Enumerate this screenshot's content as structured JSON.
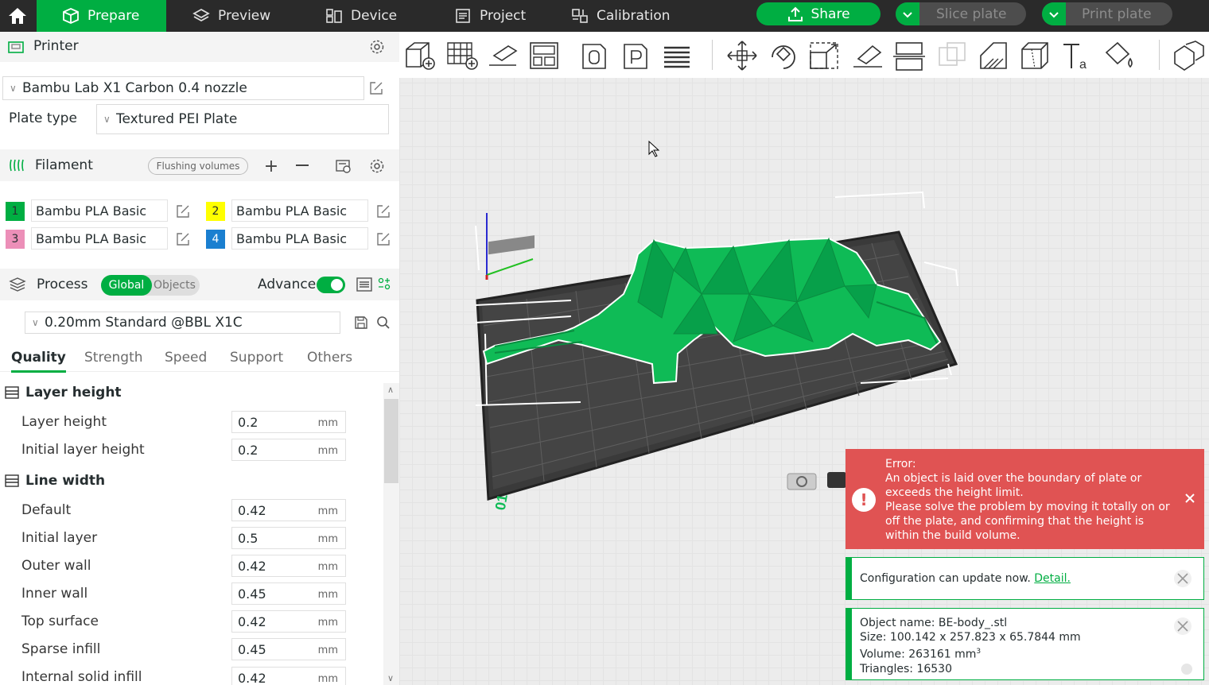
{
  "nav": {
    "tabs": [
      {
        "label": "Prepare"
      },
      {
        "label": "Preview"
      },
      {
        "label": "Device"
      },
      {
        "label": "Project"
      },
      {
        "label": "Calibration"
      }
    ],
    "share_label": "Share",
    "slice_label": "Slice plate",
    "print_label": "Print plate"
  },
  "printer": {
    "section_label": "Printer",
    "preset": "Bambu Lab X1 Carbon 0.4 nozzle",
    "plate_type_label": "Plate type",
    "plate_type": "Textured PEI Plate"
  },
  "filament": {
    "section_label": "Filament",
    "flushing_label": "Flushing volumes",
    "items": [
      {
        "num": "1",
        "name": "Bambu PLA Basic",
        "color": "#00ae42"
      },
      {
        "num": "2",
        "name": "Bambu PLA Basic",
        "color": "#ffff00"
      },
      {
        "num": "3",
        "name": "Bambu PLA Basic",
        "color": "#ec8fb8"
      },
      {
        "num": "4",
        "name": "Bambu PLA Basic",
        "color": "#1a7fd0"
      }
    ]
  },
  "process": {
    "section_label": "Process",
    "global_label": "Global",
    "objects_label": "Objects",
    "advance_label": "Advance",
    "preset": "0.20mm Standard @BBL X1C",
    "tabs": [
      "Quality",
      "Strength",
      "Speed",
      "Support",
      "Others"
    ],
    "layer_group": "Layer height",
    "layer_params": [
      {
        "label": "Layer height",
        "value": "0.2",
        "unit": "mm"
      },
      {
        "label": "Initial layer height",
        "value": "0.2",
        "unit": "mm"
      }
    ],
    "width_group": "Line width",
    "width_params": [
      {
        "label": "Default",
        "value": "0.42",
        "unit": "mm"
      },
      {
        "label": "Initial layer",
        "value": "0.5",
        "unit": "mm"
      },
      {
        "label": "Outer wall",
        "value": "0.42",
        "unit": "mm"
      },
      {
        "label": "Inner wall",
        "value": "0.45",
        "unit": "mm"
      },
      {
        "label": "Top surface",
        "value": "0.42",
        "unit": "mm"
      },
      {
        "label": "Sparse infill",
        "value": "0.45",
        "unit": "mm"
      },
      {
        "label": "Internal solid infill",
        "value": "0.42",
        "unit": "mm"
      }
    ]
  },
  "plate": {
    "label": "01"
  },
  "error": {
    "title": "Error:",
    "message": "An object is laid over the boundary of plate or exceeds the height limit.",
    "detail": "Please solve the problem by moving it totally on or off the plate, and confirming that the height is within the build volume."
  },
  "config_note": {
    "text": "Configuration can update now.",
    "link": "Detail."
  },
  "object_info": {
    "name": "Object name: BE-body_.stl",
    "size": "Size: 100.142 x 257.823 x 65.7844 mm",
    "volume": "Volume: 263161 mm",
    "volume_sup": "3",
    "triangles": "Triangles: 16530"
  },
  "colors": {
    "accent": "#00ae42",
    "error": "#e05353",
    "topbar": "#2a2a2a"
  }
}
